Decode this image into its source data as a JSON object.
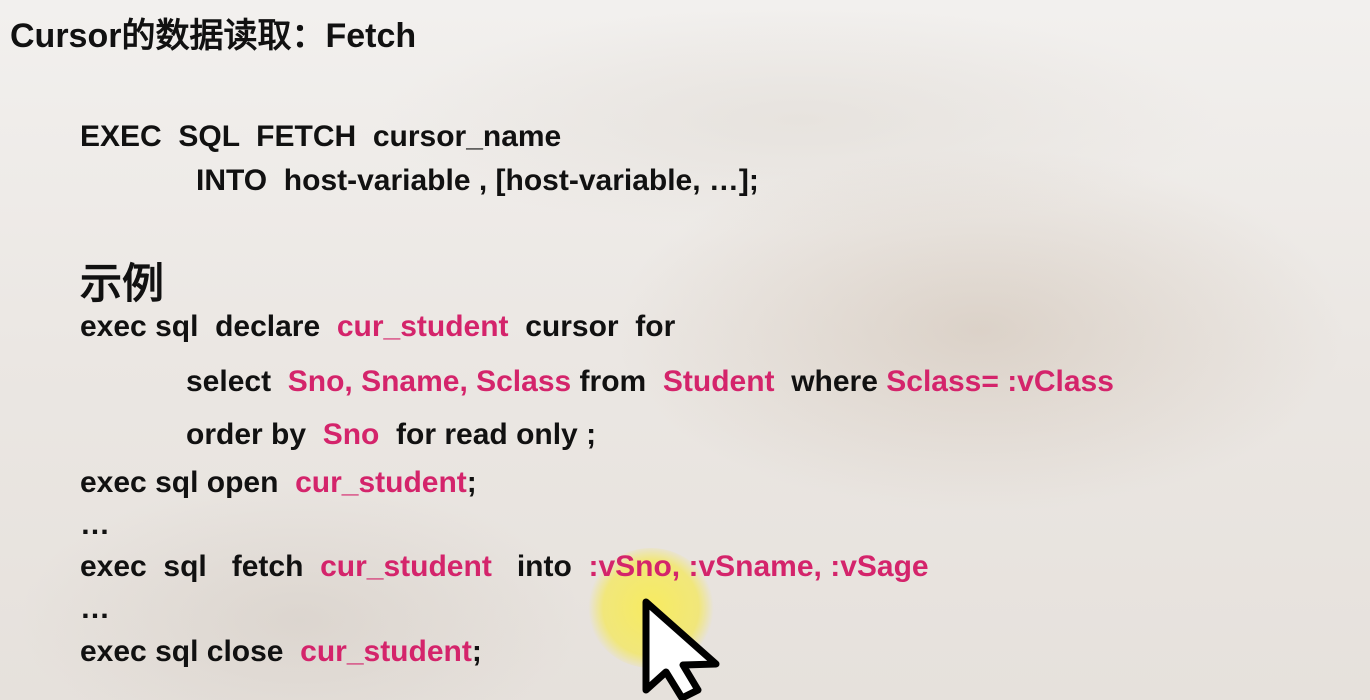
{
  "title": "Cursor的数据读取：Fetch",
  "syntax": {
    "line1": "EXEC  SQL  FETCH  cursor_name",
    "line2": "INTO  host-variable , [host-variable, …];"
  },
  "example_heading": "示例",
  "example": {
    "l1_a": "exec sql  declare  ",
    "l1_b": "cur_student",
    "l1_c": "  cursor  for",
    "l2_a": "select  ",
    "l2_b": "Sno, Sname, Sclass",
    "l2_c": " from  ",
    "l2_d": "Student",
    "l2_e": "  where ",
    "l2_f": "Sclass= :vClass",
    "l3_a": "order by  ",
    "l3_b": "Sno",
    "l3_c": "  for read only ;",
    "l4_a": "exec sql open  ",
    "l4_b": "cur_student",
    "l4_c": ";",
    "ellipsis1": "…",
    "l5_a": "exec  sql   fetch  ",
    "l5_b": "cur_student",
    "l5_c": "   into  ",
    "l5_d": ":vSno, :vSname, :vSage",
    "ellipsis2": "…",
    "l6_a": "exec sql close  ",
    "l6_b": "cur_student",
    "l6_c": ";"
  },
  "colors": {
    "highlight": "#d4246b",
    "text": "#111111",
    "pointer_highlight": "#f4e85a"
  },
  "icons": {
    "pointer": "mouse-pointer-icon"
  }
}
